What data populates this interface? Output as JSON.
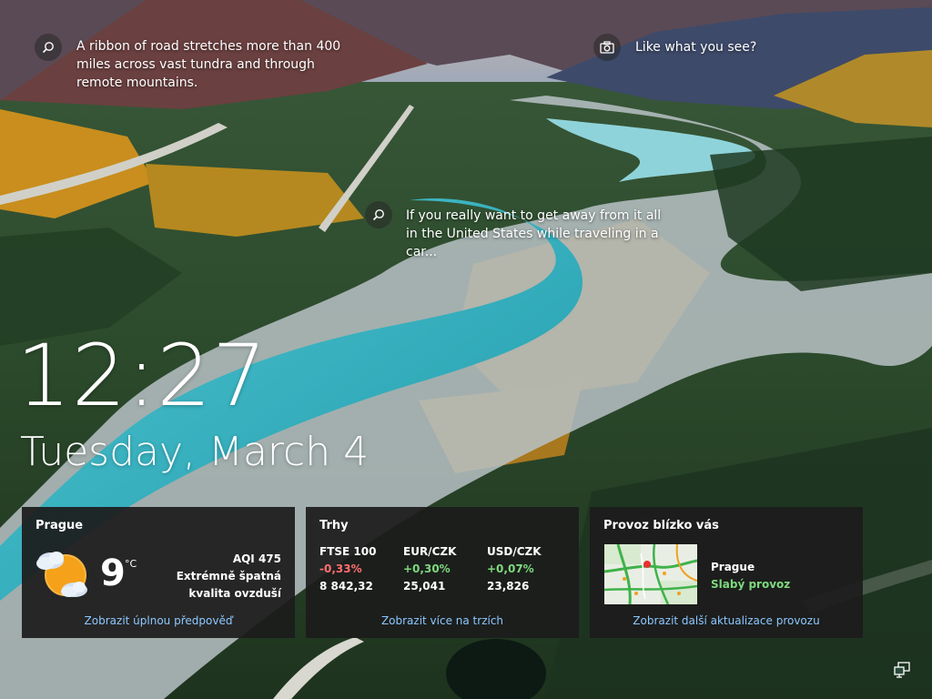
{
  "spotlight": {
    "hotspot_1": "A ribbon of road stretches more than 400 miles across vast tundra and through remote mountains.",
    "hotspot_2": "Like what you see?",
    "hotspot_3": "If you really want to get away from it all in the United States while traveling in a car..."
  },
  "clock": {
    "time": "12:27",
    "date": "Tuesday, March 4"
  },
  "weather": {
    "city": "Prague",
    "icon": "partly-cloudy-icon",
    "temperature": "9",
    "unit": "°C",
    "aqi": "AQI 475",
    "aqi_desc_1": "Extrémně špatná",
    "aqi_desc_2": "kvalita ovzduší",
    "link": "Zobrazit úplnou předpověď"
  },
  "markets": {
    "title": "Trhy",
    "items": [
      {
        "name": "FTSE 100",
        "change": "-0,33%",
        "value": "8 842,32"
      },
      {
        "name": "EUR/CZK",
        "change": "+0,30%",
        "value": "25,041"
      },
      {
        "name": "USD/CZK",
        "change": "+0,07%",
        "value": "23,826"
      }
    ],
    "link": "Zobrazit více na trzích"
  },
  "traffic": {
    "title": "Provoz blízko vás",
    "city": "Prague",
    "status": "Slabý provoz",
    "link": "Zobrazit další aktualizace provozu"
  },
  "colors": {
    "negative": "#ff6f6f",
    "positive": "#7ed97e",
    "link": "#8cc8ff",
    "card_bg": "#1c1c1c"
  },
  "system_tray": {
    "icon": "network-icon"
  }
}
